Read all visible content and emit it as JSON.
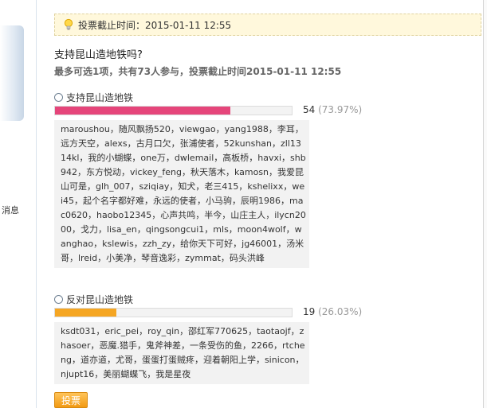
{
  "sidebar": {
    "message_label": "消息"
  },
  "deadline": {
    "text": "投票截止时间：2015-01-11 12:55"
  },
  "poll": {
    "title": "支持昆山造地铁吗?",
    "info": "最多可选1项，共有73人参与，投票截止时间2015-01-11 12:55"
  },
  "options": [
    {
      "label": "支持昆山造地铁",
      "votes": "54",
      "percent_text": "(73.97%)",
      "percent": 73.97,
      "bar_color": "#e5457a",
      "voters": "maroushou，随风飘扬520，viewgao，yang1988，李耳，远方天空，alexs，古月口欠，张浦使者，52kunshan，zll1314kl，我的小蝴蝶，one万，dwlemail，高板桥，havxi，shb942，东方悦动，vickey_feng，秋天落木，kamosn，我爱昆山可是，glh_007，sziqiay，知犬，老三415，kshelixx，wei45，起个名字都好难，永远的使者，小马驹，辰明1986，mac0620，haobo12345，心声共鸣，半今，山庄主人，ilycn2000，戈力，lisa_en，qingsongcui1，mls，moon4wolf，wanghao，kslewis，zzh_zy，给你天下可好，jg46001，汤米哥，lreid，小美净，琴音逸彩，zymmat，码头洪峰"
    },
    {
      "label": "反对昆山造地铁",
      "votes": "19",
      "percent_text": "(26.03%)",
      "percent": 26.03,
      "bar_color": "#f5a623",
      "voters": "ksdt031，eric_pei，roy_qin，邵红军770625，taotaojf，zhasoer，恶魔.猎手，鬼斧神差，一条受伤的鱼，2266，rtcheng，道亦道，尤哥，蛋蛋打蛋贼疼，迎着朝阳上学，sinicon，njupt16，美丽蝴蝶飞，我是星夜"
    }
  ],
  "vote_button": {
    "label": "投票"
  },
  "icons": {
    "deadline": "lightbulb-icon",
    "option": "radio-icon"
  }
}
